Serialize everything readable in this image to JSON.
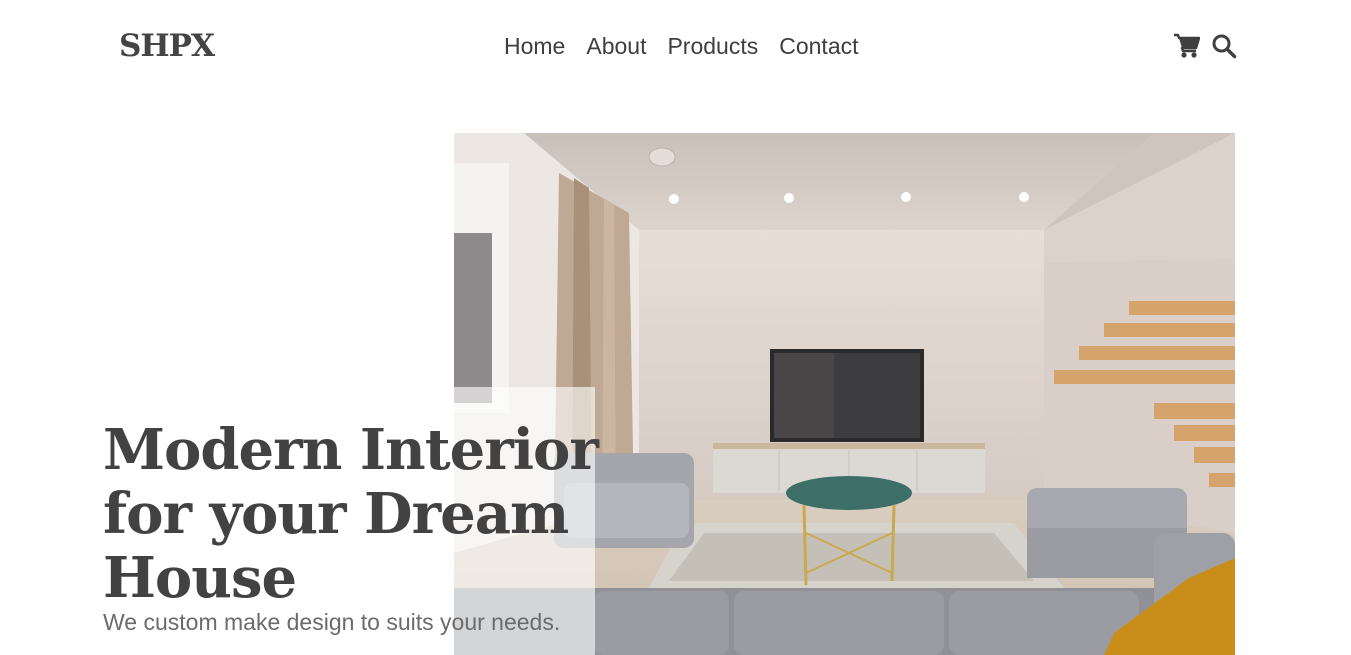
{
  "brand": {
    "logo_text": "SHPX"
  },
  "nav": {
    "links": [
      {
        "label": "Home"
      },
      {
        "label": "About"
      },
      {
        "label": "Products"
      },
      {
        "label": "Contact"
      }
    ],
    "icons": [
      "cart-icon",
      "search-icon"
    ]
  },
  "hero": {
    "title": "Modern Interior for your Dream House",
    "subtitle": "We custom make design to suits your needs.",
    "image": "living-room-photo"
  },
  "colors": {
    "text": "#444444",
    "subtitle": "#6b6b6b",
    "background": "#ffffff"
  }
}
